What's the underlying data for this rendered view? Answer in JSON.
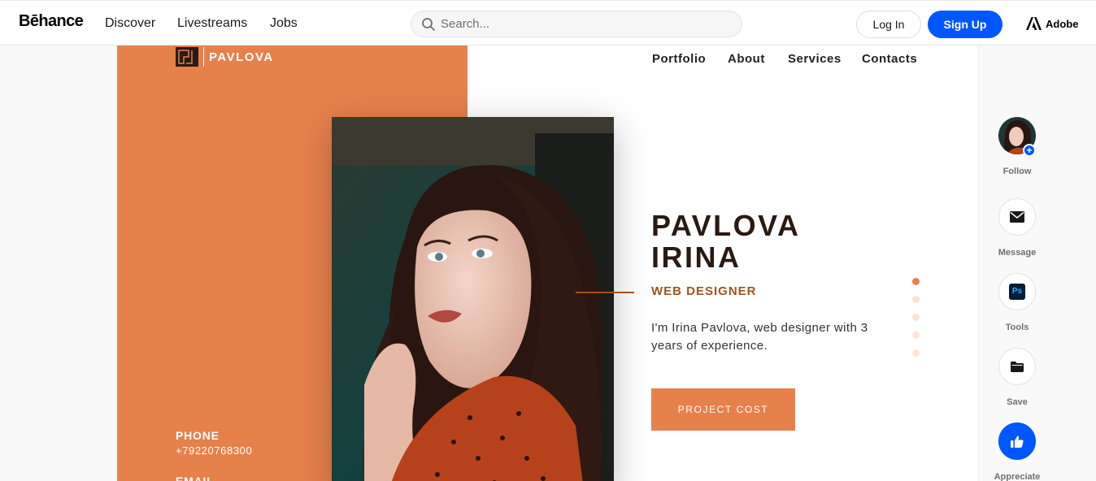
{
  "topbar": {
    "logo": "Bēhance",
    "nav": [
      "Discover",
      "Livestreams",
      "Jobs"
    ],
    "search_placeholder": "Search...",
    "login_label": "Log In",
    "signup_label": "Sign Up",
    "adobe_label": "Adobe"
  },
  "project": {
    "brand_name": "PAVLOVA",
    "site_nav": [
      "Portfolio",
      "About",
      "Services",
      "Contacts"
    ],
    "hero_name_line1": "PAVLOVA",
    "hero_name_line2": "IRINA",
    "hero_role": "WEB DESIGNER",
    "hero_desc": "I'm Irina Pavlova, web designer with 3 years of experience.",
    "cta_label": "PROJECT COST",
    "phone_label": "PHONE",
    "phone_value": "+79220768300",
    "email_label": "EMAIL",
    "slides": {
      "count": 5,
      "active": 1
    }
  },
  "rail": {
    "follow": "Follow",
    "message": "Message",
    "tools": "Tools",
    "tool_badge": "Ps",
    "save": "Save",
    "appreciate": "Appreciate"
  },
  "colors": {
    "accent_orange": "#e7814c",
    "accent_brown": "#a0531f",
    "behance_blue": "#0057ff",
    "dark_text": "#2a1a12"
  }
}
